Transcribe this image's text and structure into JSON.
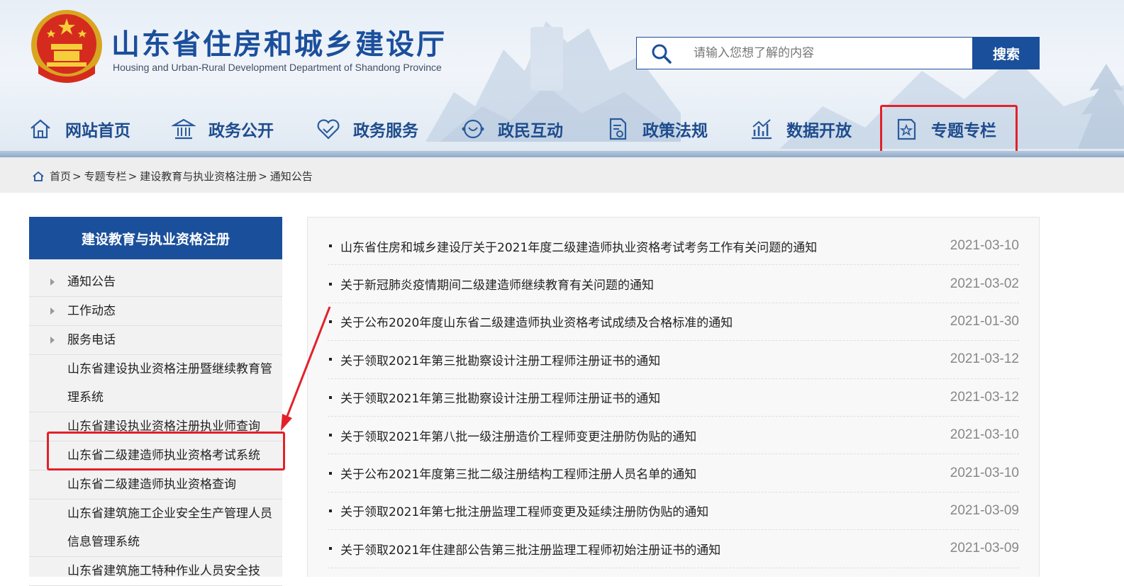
{
  "header": {
    "title": "山东省住房和城乡建设厅",
    "subtitle": "Housing and Urban-Rural Development Department of Shandong Province",
    "emblem_icon": "national-emblem-icon"
  },
  "search": {
    "placeholder": "请输入您想了解的内容",
    "button_label": "搜索"
  },
  "nav": {
    "items": [
      {
        "label": "网站首页",
        "icon": "home-icon"
      },
      {
        "label": "政务公开",
        "icon": "government-building-icon"
      },
      {
        "label": "政务服务",
        "icon": "handshake-icon"
      },
      {
        "label": "政民互动",
        "icon": "interaction-icon"
      },
      {
        "label": "政策法规",
        "icon": "document-icon"
      },
      {
        "label": "数据开放",
        "icon": "chart-icon"
      },
      {
        "label": "专题专栏",
        "icon": "star-document-icon"
      }
    ]
  },
  "breadcrumb": {
    "items": [
      "首页",
      "专题专栏",
      "建设教育与执业资格注册",
      "通知公告"
    ],
    "separator": ">"
  },
  "sidebar": {
    "title": "建设教育与执业资格注册",
    "items": [
      {
        "label": "通知公告"
      },
      {
        "label": "工作动态"
      },
      {
        "label": "服务电话"
      },
      {
        "label": "山东省建设执业资格注册暨继续教育管理系统"
      },
      {
        "label": "山东省建设执业资格注册执业师查询"
      },
      {
        "label": "山东省二级建造师执业资格考试系统"
      },
      {
        "label": "山东省二级建造师执业资格查询"
      },
      {
        "label": "山东省建筑施工企业安全生产管理人员信息管理系统"
      },
      {
        "label": "山东省建筑施工特种作业人员安全技"
      }
    ]
  },
  "news": {
    "items": [
      {
        "title": "山东省住房和城乡建设厅关于2021年度二级建造师执业资格考试考务工作有关问题的通知",
        "date": "2021-03-10"
      },
      {
        "title": "关于新冠肺炎疫情期间二级建造师继续教育有关问题的通知",
        "date": "2021-03-02"
      },
      {
        "title": "关于公布2020年度山东省二级建造师执业资格考试成绩及合格标准的通知",
        "date": "2021-01-30"
      },
      {
        "title": "关于领取2021年第三批勘察设计注册工程师注册证书的通知",
        "date": "2021-03-12"
      },
      {
        "title": "关于领取2021年第三批勘察设计注册工程师注册证书的通知",
        "date": "2021-03-12"
      },
      {
        "title": "关于领取2021年第八批一级注册造价工程师变更注册防伪贴的通知",
        "date": "2021-03-10"
      },
      {
        "title": "关于公布2021年度第三批二级注册结构工程师注册人员名单的通知",
        "date": "2021-03-10"
      },
      {
        "title": "关于领取2021年第七批注册监理工程师变更及延续注册防伪贴的通知",
        "date": "2021-03-09"
      },
      {
        "title": "关于领取2021年住建部公告第三批注册监理工程师初始注册证书的通知",
        "date": "2021-03-09"
      }
    ]
  },
  "colors": {
    "brand_blue": "#1a4f9b",
    "nav_text": "#1e4c8d",
    "annotation_red": "#e3202a"
  }
}
